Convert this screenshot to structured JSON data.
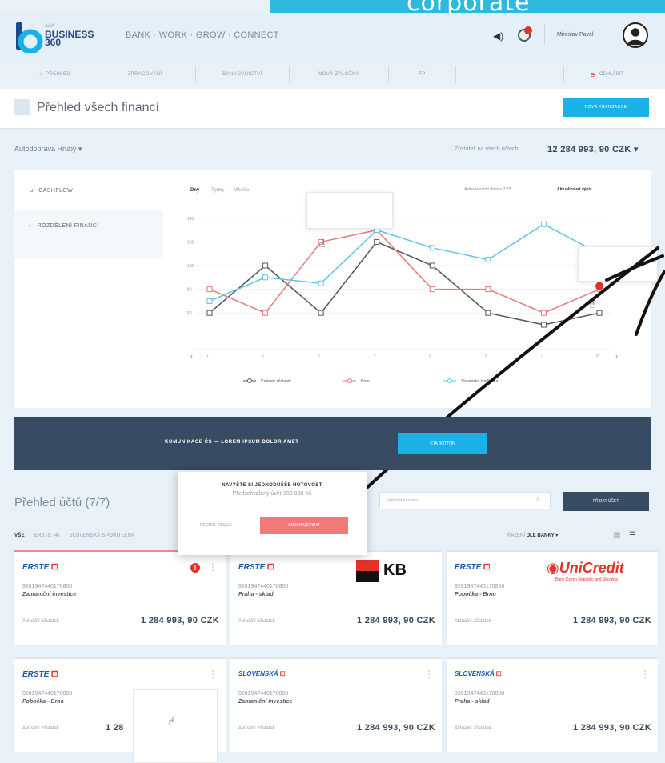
{
  "corporate_banner": "corporate",
  "header": {
    "logo_small": "AAA",
    "logo_main": "BUSINESS",
    "logo_sub": "360",
    "tagline": "BANK · WORK · GROW · CONNECT",
    "user_name": "Miroslav Pavel",
    "notification_count": "1"
  },
  "nav": {
    "tabs": [
      "PŘEHLED",
      "ZPRACOVÁNÍ",
      "BANKOVNICTVÍ",
      "NOVÁ ZÁLOŽKA",
      "FP"
    ],
    "logout": "ODHLÁSIT"
  },
  "page": {
    "title": "Přehled všech financí",
    "new_transaction": "NOVÁ TRANSAKCE"
  },
  "company": {
    "name": "Autodoprava Hrubý ▾",
    "balance_label": "Zůstatek na všech účtech",
    "balance_value": "12 284 993, 90 CZK ▾"
  },
  "side_menu": {
    "cashflow": "CASHFLOW",
    "distribution": "ROZDĚLENÍ FINANCÍ"
  },
  "chart_controls": {
    "tabs": [
      "Dny",
      "Týdny",
      "Měsíce"
    ],
    "updated": "Aktualizováno dnes v 7:32",
    "refresh": "Aktualizovat výpis"
  },
  "chart_data": {
    "type": "line",
    "title": "",
    "xlabel": "",
    "ylabel": "",
    "x": [
      "1",
      "2",
      "3",
      "4",
      "5",
      "6",
      "7",
      "8"
    ],
    "yticks": [
      "140",
      "120",
      "100",
      "80",
      "60"
    ],
    "ylim": [
      50,
      150
    ],
    "series": [
      {
        "name": "Celkový zůstatek",
        "color": "#555555",
        "values": [
          60,
          100,
          60,
          120,
          100,
          60,
          50,
          60
        ]
      },
      {
        "name": "Brno",
        "color": "#e87878",
        "values": [
          80,
          60,
          120,
          130,
          80,
          80,
          60,
          80
        ]
      },
      {
        "name": "Slovenská spořitelna",
        "color": "#5fc3ea",
        "values": [
          70,
          90,
          85,
          130,
          115,
          105,
          135,
          110
        ]
      }
    ],
    "legend": "bottom"
  },
  "banner": {
    "text": "KOMUNIKACE ČS — LOREM IPSUM DOLOR AMET",
    "button": "CTA BOTTON"
  },
  "accounts": {
    "title": "Přehled účtů (7/7)",
    "search_placeholder": "Vyhledat transakci",
    "add_account": "PŘIDAT ÚČET",
    "filters": [
      "VŠE",
      "ERSTE (4)",
      "SLOVENSKÁ SPOŘITELNA"
    ],
    "sort_label": "ŘAZENÍ",
    "sort_value": "DLE BANKY ▾",
    "cards": [
      {
        "bank": "ERSTE",
        "iban": "9281947440170800",
        "name": "Zahraniční investice",
        "label": "Aktuální zůstatek",
        "value": "1 284 993, 90 CZK"
      },
      {
        "bank": "ERSTE",
        "iban": "9281947440170800",
        "name": "Praha - sklad",
        "label": "Aktuální zůstatek",
        "value": "1 284 993, 90 CZK"
      },
      {
        "bank": "ERSTE",
        "iban": "9281947440170800",
        "name": "Pobočka - Brno",
        "label": "Aktuální zůstatek",
        "value": "1 284 993, 90 CZK"
      },
      {
        "bank": "ERSTE",
        "iban": "9281947440170800",
        "name": "Pobočka - Brno",
        "label": "Aktuální zůstatek",
        "value": "1 28"
      },
      {
        "bank": "SLOVENSKÁ",
        "iban": "9281947440170800",
        "name": "Zahraniční investice",
        "label": "Aktuální zůstatek",
        "value": "1 284 993, 90 CZK"
      },
      {
        "bank": "SLOVENSKÁ",
        "iban": "9281947440170800",
        "name": "Praha - sklad",
        "label": "Aktuální zůstatek",
        "value": "1 284 993, 90 CZK"
      }
    ]
  },
  "popup": {
    "heading": "NAVYŠTE SI JEDNODUŠŠE HOTOVOST",
    "subtext": "Předschválený úvěr 300 000 Kč",
    "dismiss": "NECHCI, DĚKUJI",
    "accept": "CHCI NAČERPAT"
  },
  "logos": {
    "kb": "KB",
    "unicredit": "UniCredit",
    "unicredit_sub": "Bank Czech Republic and Slovakia"
  }
}
